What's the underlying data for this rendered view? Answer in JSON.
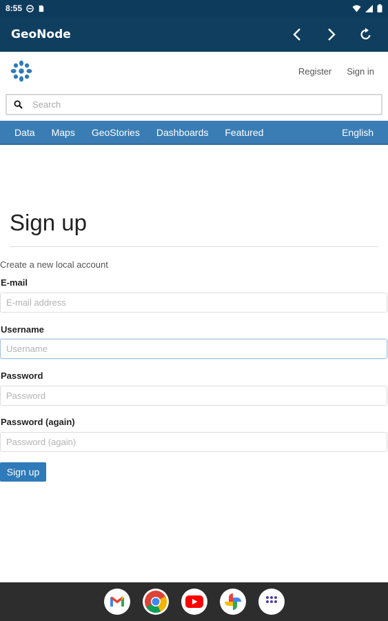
{
  "status_bar": {
    "time": "8:55"
  },
  "app_bar": {
    "title": "GeoNode"
  },
  "header": {
    "register": "Register",
    "signin": "Sign in"
  },
  "search": {
    "placeholder": "Search"
  },
  "menu": {
    "items": [
      "Data",
      "Maps",
      "GeoStories",
      "Dashboards",
      "Featured"
    ],
    "language": "English"
  },
  "form": {
    "title": "Sign up",
    "subtitle": "Create a new local account",
    "email_label": "E-mail",
    "email_placeholder": "E-mail address",
    "username_label": "Username",
    "username_placeholder": "Username",
    "password_label": "Password",
    "password_placeholder": "Password",
    "password2_label": "Password (again)",
    "password2_placeholder": "Password (again)",
    "submit": "Sign up"
  },
  "colors": {
    "app_bar": "#0f3e5f",
    "menu_bar": "#3a7db5",
    "button": "#2f7ab8"
  },
  "dock": {
    "apps": [
      "gmail-icon",
      "chrome-icon",
      "youtube-icon",
      "photos-icon",
      "app-drawer-icon"
    ]
  }
}
